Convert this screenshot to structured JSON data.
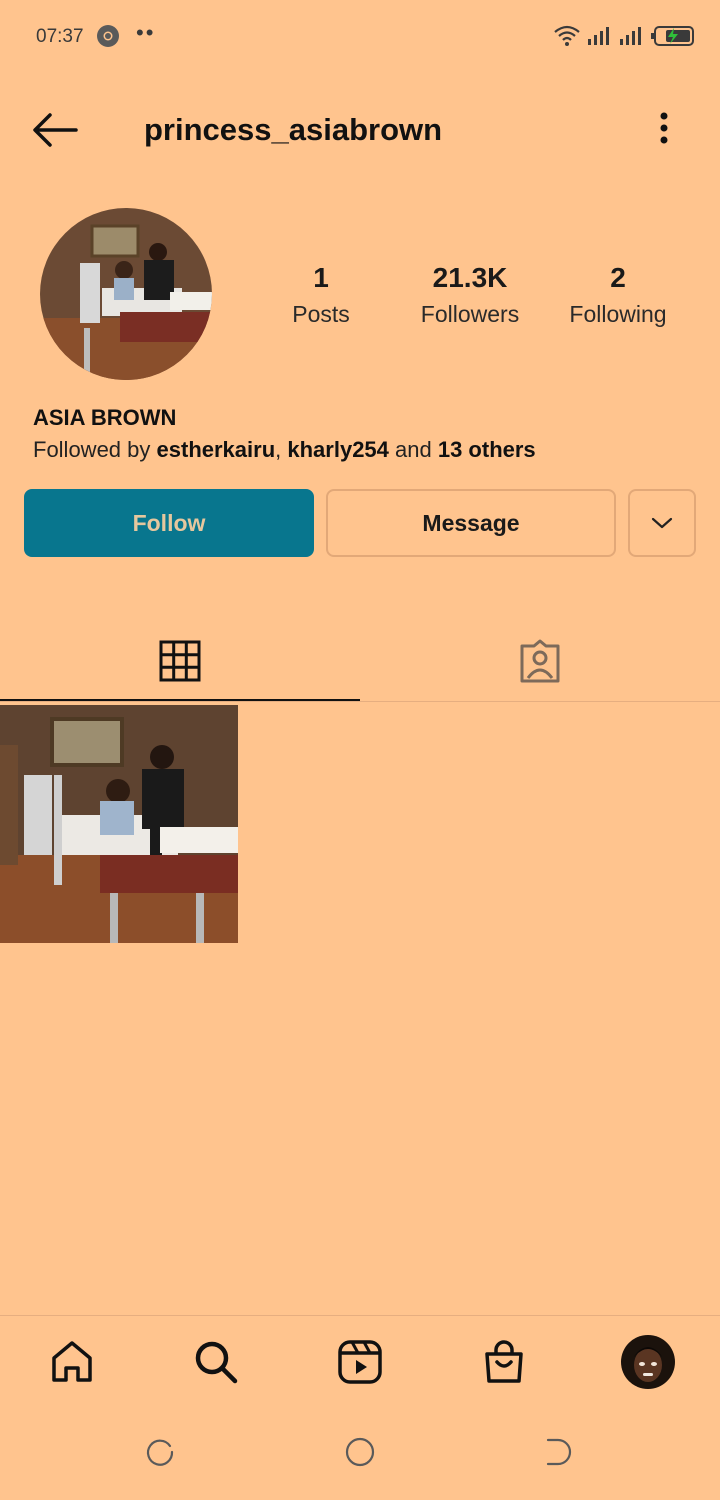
{
  "status_bar": {
    "time": "07:37",
    "notification_dots": "••"
  },
  "header": {
    "username": "princess_asiabrown"
  },
  "profile": {
    "stats": {
      "posts": {
        "count": "1",
        "label": "Posts"
      },
      "followers": {
        "count": "21.3K",
        "label": "Followers"
      },
      "following": {
        "count": "2",
        "label": "Following"
      }
    },
    "full_name": "ASIA BROWN",
    "followed_by": {
      "prefix": "Followed by ",
      "user1": "estherkairu",
      "sep": ", ",
      "user2": "kharly254",
      "and": " and ",
      "others": "13 others"
    }
  },
  "actions": {
    "follow_label": "Follow",
    "message_label": "Message"
  },
  "colors": {
    "background": "#FFC48E",
    "follow_button": "#08768E",
    "follow_text": "#E5C79E",
    "outline": "#E2A878"
  },
  "icons": {
    "back": "arrow-left-icon",
    "more": "more-vertical-icon",
    "dropdown": "chevron-down-icon",
    "grid_tab": "grid-icon",
    "tagged_tab": "tagged-person-icon",
    "home": "home-icon",
    "search": "search-icon",
    "reels": "reels-icon",
    "shop": "shopping-bag-icon",
    "recent_apps": "recent-apps-icon",
    "home_system": "circle-home-icon",
    "back_system": "back-gesture-icon"
  }
}
